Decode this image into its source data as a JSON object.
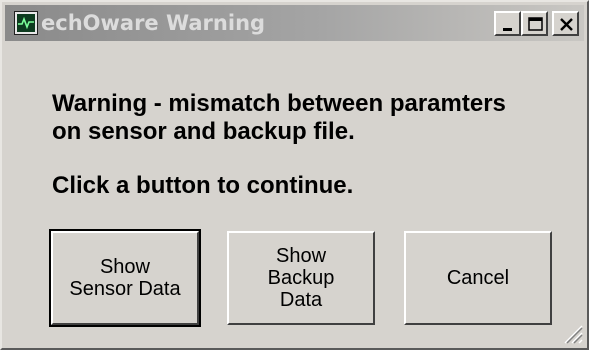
{
  "window": {
    "title": "echOware Warning",
    "app_icon": "waveform-app-icon",
    "controls": {
      "minimize": "minimize-icon",
      "maximize": "maximize-icon",
      "close": "close-icon"
    }
  },
  "message": {
    "line1": "Warning - mismatch between paramters",
    "line2": "on sensor and backup file.",
    "line3": "Click a button to continue."
  },
  "buttons": {
    "show_sensor_data": "Show\nSensor Data",
    "show_backup_data": "Show\nBackup\nData",
    "cancel": "Cancel"
  },
  "colors": {
    "dialog_background": "#d6d3ce",
    "titlebar_inactive": "#8a8a8a",
    "title_text": "#dcdcdc"
  }
}
